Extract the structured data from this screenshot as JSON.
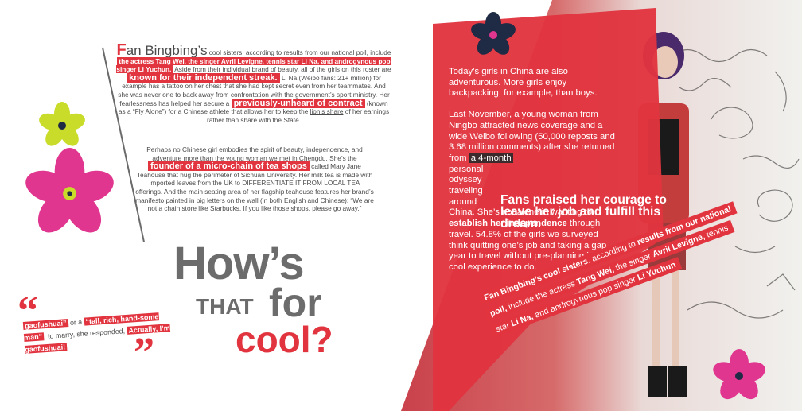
{
  "left": {
    "article1": {
      "dropcap": "F",
      "lead_word": "an Bingbing’s",
      "t1": " cool sisters, according to results from our national poll, include ",
      "hl1": "the actress Tang Wei, the singer Avril Levigne, tennis star Li Na, and androgynous pop singer Li Yuchun.",
      "t2": " Aside from their individual brand of beauty, all of the girls on this roster are ",
      "hl2": "known for their independent streak.",
      "t3": " Li Na (Weibo fans: 21+ million) for example has a tattoo on her chest that she had kept secret even from her teammates. And she was never one to back away from confrontation with the government’s sport ministry. Her fearlessness has helped her secure a ",
      "hl3": "previously-unheard of contract",
      "t4": " (known as a “Fly Alone”) for a Chinese athlete that allows her to keep the ",
      "u1": "lion’s share",
      "t5": " of her earnings rather than share with the State."
    },
    "article2": {
      "t1": "Perhaps no Chinese girl embodies the spirit of beauty, independence, and adventure more than the young woman we met in Chengdu. She’s the ",
      "hl1": "founder of a micro-chain of tea shops",
      "t2": " called Mary Jane Teahouse that hug the perimeter of Sichuan University. Her milk tea is made with imported leaves from the UK to DIFFERENTIATE IT FROM LOCAL TEA offerings. And the main seating area of her flagship teahouse features her brand’s manifesto painted in big letters on the wall (in both English and Chinese): “We are not a chain store like Starbucks. If you like those shops, please go away.”"
    },
    "headline": {
      "hows": "How’s",
      "that": "THAT",
      "for": "for",
      "cool": "cool?"
    },
    "quote": {
      "open_mark": "“",
      "close_mark": "”",
      "hl1": "gaofushuai”",
      "t1": " or a ",
      "hl2": "“tall, rich, hand-some man”",
      "t2": ", to marry, she responded, ",
      "hl3": "Actually, I’m gaofushuai!"
    }
  },
  "right": {
    "p1": "Today’s girls in China are also adventurous. More girls enjoy backpacking, for example, than boys.",
    "p2a": "Last November, a young woman from Ningbo attracted news coverage and a wide Weibo following (50,000 reposts and 3.68 million comments) after she returned from ",
    "p2hl": "a 4-month",
    "p2b": "personal odyssey traveling around",
    "p2c": " China. She’s not alone in wanting to ",
    "p2u": "establish her independence",
    "p2d": " through travel. 54.8% of the girls we surveyed think quitting one’s job and taking a gap year to travel without pre-planning is a cool experience to do.",
    "pull_quote": "Fans praised her courage to leave her job and fulfill this dream.",
    "banner": {
      "l1a": "Fan Bingbing’s cool sisters,",
      "l1b": " according to ",
      "l1c": "results from our national",
      "l2a": "poll,",
      "l2b": " include the actress ",
      "l2c": "Tang Wei,",
      "l2d": " the singer ",
      "l2e": "Avril Levigne,",
      "l2f": " tennis",
      "l3a": "star ",
      "l3b": "Li Na,",
      "l3c": " and androgynous pop singer ",
      "l3d": "Li Yuchun"
    }
  },
  "colors": {
    "accent_red": "#e1343f",
    "headline_gray": "#6c6c6c",
    "flower_pink": "#e0368f",
    "flower_lime": "#c9dc2a",
    "flower_navy": "#1f2a44"
  },
  "icons": [
    "flower-lime-icon",
    "flower-pink-icon",
    "flower-navy-icon",
    "flower-pink-small-icon"
  ]
}
